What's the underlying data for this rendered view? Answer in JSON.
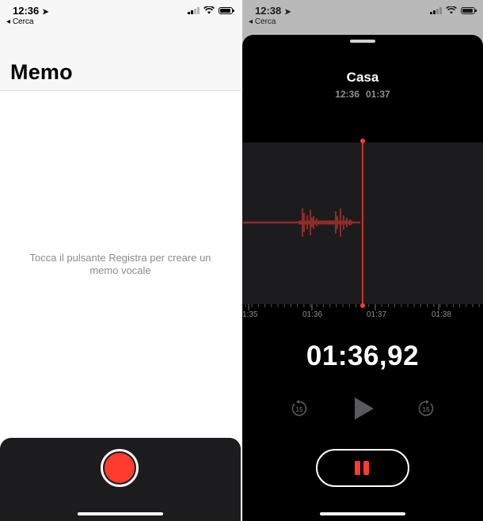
{
  "left": {
    "status": {
      "time": "12:36",
      "back": "Cerca"
    },
    "title": "Memo",
    "empty_message": "Tocca il pulsante Registra per creare un memo vocale"
  },
  "right": {
    "status": {
      "time": "12:38",
      "back": "Cerca"
    },
    "recording": {
      "name": "Casa",
      "time": "12:36",
      "duration": "01:37"
    },
    "timeline_labels": [
      "1:35",
      "01:36",
      "01:37",
      "01:38"
    ],
    "elapsed": "01:36,92",
    "skip_back_label": "15",
    "skip_forward_label": "15"
  },
  "colors": {
    "record_red": "#ff3b30",
    "dark_panel": "#1c1c1e",
    "playhead": "#ff3b30"
  },
  "icons": [
    "location-arrow-icon",
    "back-arrow-icon",
    "signal-icon",
    "wifi-icon",
    "battery-icon",
    "record-icon",
    "skip-back-15-icon",
    "play-icon",
    "skip-forward-15-icon",
    "pause-icon"
  ]
}
